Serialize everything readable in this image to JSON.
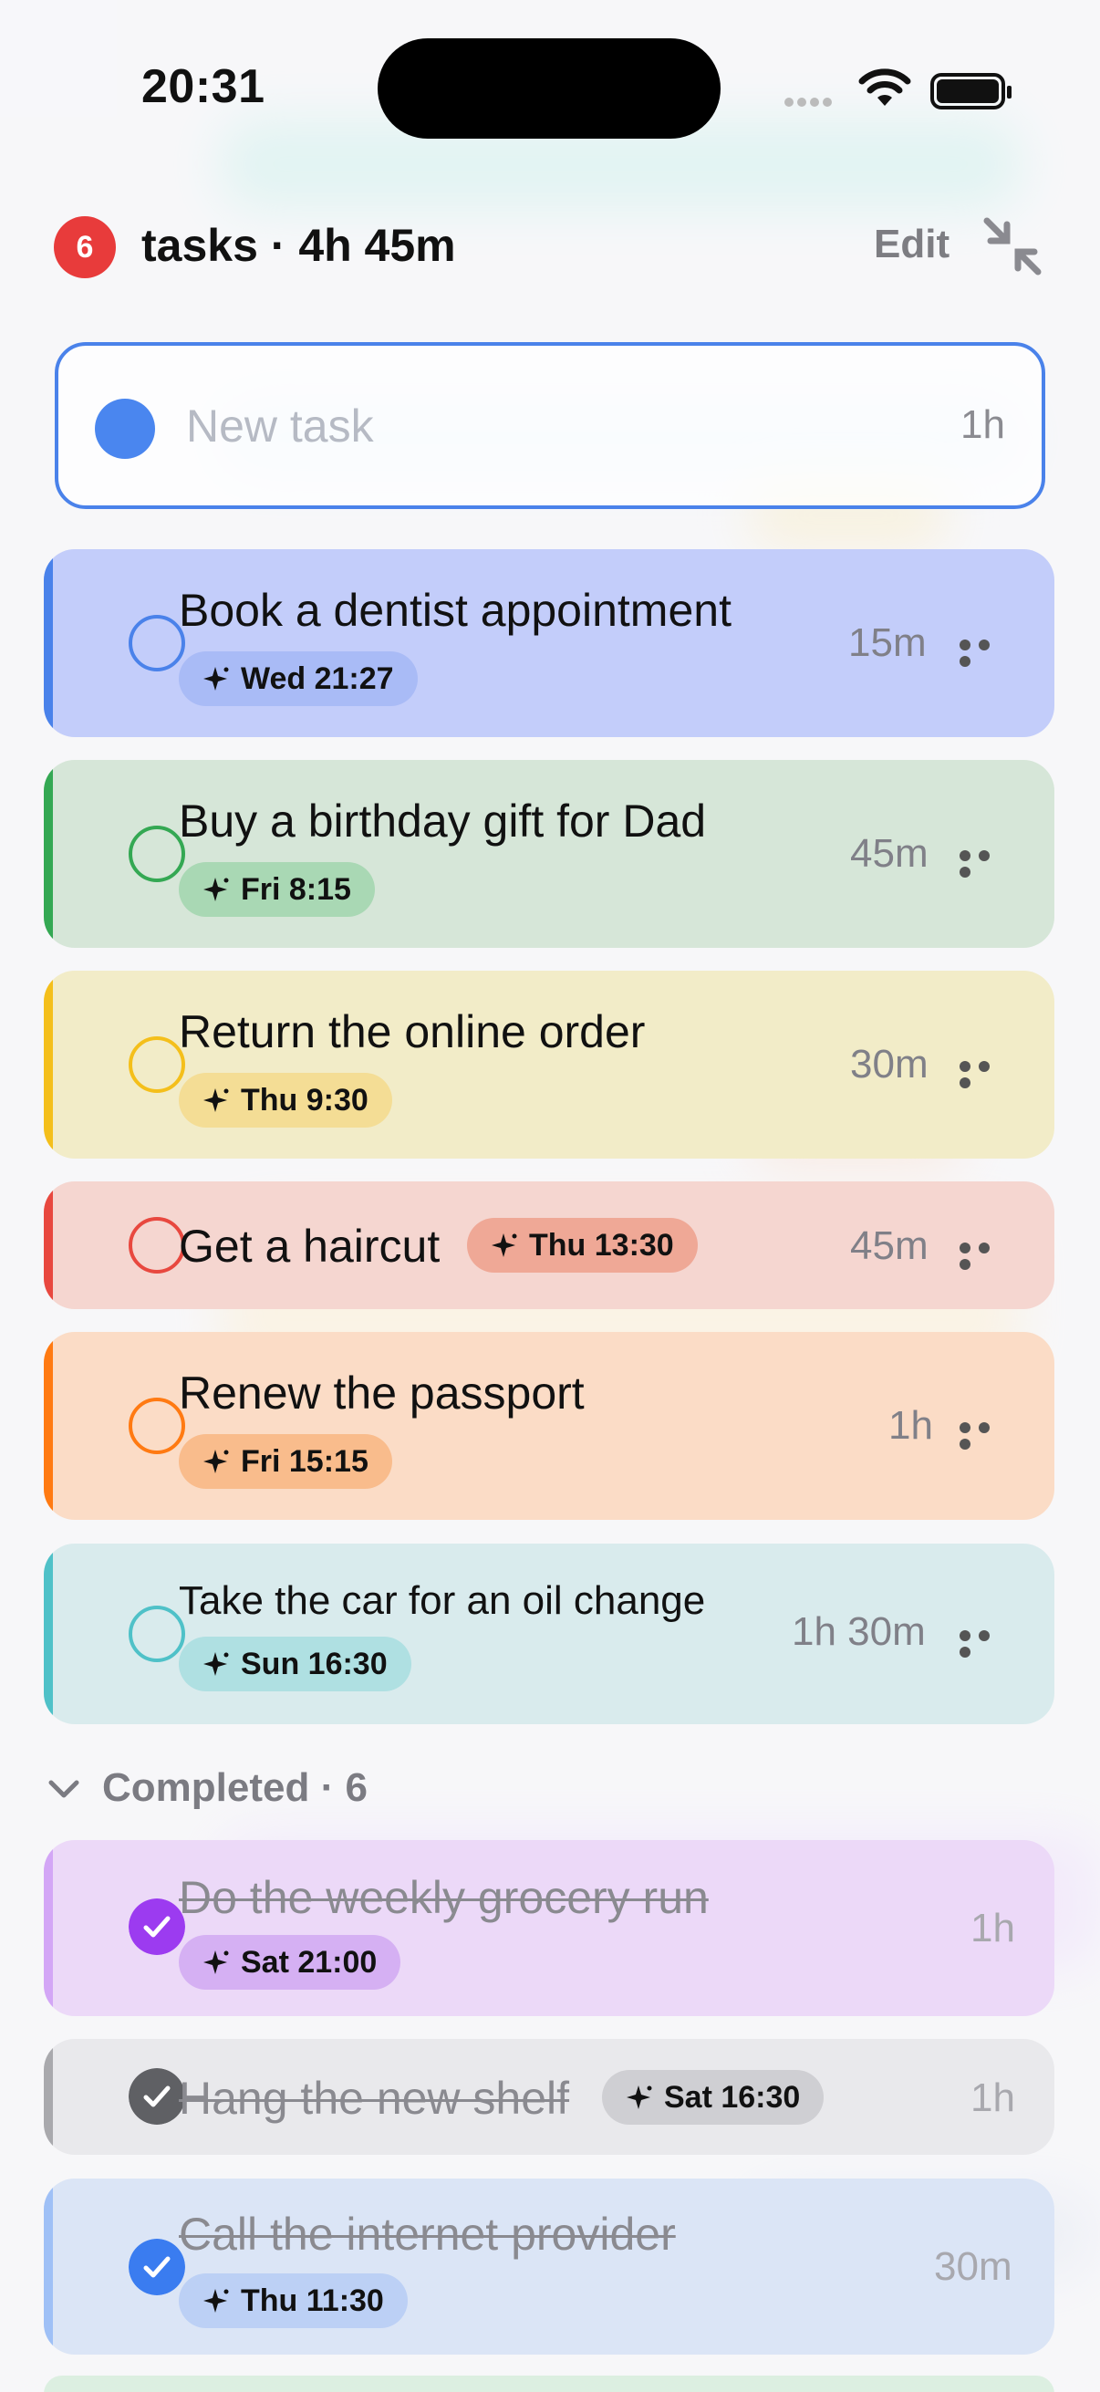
{
  "status_bar": {
    "time": "20:31"
  },
  "header": {
    "count": "6",
    "title": "tasks · 4h 45m",
    "edit_label": "Edit"
  },
  "new_task": {
    "placeholder": "New task",
    "duration": "1h",
    "color": "#4a86ef"
  },
  "tasks": [
    {
      "title": "Book a dentist appointment",
      "when": "Wed 21:27",
      "duration": "15m",
      "color": "#4a82ea",
      "bg": "#c3cdfa",
      "chip": "#a9bbf6"
    },
    {
      "title": "Buy a birthday gift for Dad",
      "when": "Fri 8:15",
      "duration": "45m",
      "color": "#34a853",
      "bg": "#d6e6d8",
      "chip": "#a9d8b4"
    },
    {
      "title": "Return the online order",
      "when": "Thu 9:30",
      "duration": "30m",
      "color": "#f4bf1b",
      "bg": "#f2ecc8",
      "chip": "#f4dd95"
    },
    {
      "title": "Get a haircut",
      "when": "Thu 13:30",
      "duration": "45m",
      "color": "#e8483f",
      "bg": "#f5d6d0",
      "chip": "#efa896"
    },
    {
      "title": "Renew the passport",
      "when": "Fri 15:15",
      "duration": "1h",
      "color": "#ff7a12",
      "bg": "#fbdcc6",
      "chip": "#f9bc8c"
    },
    {
      "title": "Take the car for an oil change",
      "when": "Sun 16:30",
      "duration": "1h 30m",
      "color": "#4fc1c8",
      "bg": "#d9ebed",
      "chip": "#afe0e2"
    }
  ],
  "completed": {
    "label": "Completed · 6",
    "items": [
      {
        "title": "Do the weekly grocery run",
        "when": "Sat 21:00",
        "duration": "1h",
        "color": "#9c3bf0",
        "bg": "#ecd9f8",
        "chip": "#d5b0f3"
      },
      {
        "title": "Hang the new shelf",
        "when": "Sat 16:30",
        "duration": "1h",
        "color": "#5f6064",
        "bg": "#e9e9ec",
        "chip": "#cfcfd3"
      },
      {
        "title": "Call the internet provider",
        "when": "Thu 11:30",
        "duration": "30m",
        "color": "#3a7cf0",
        "bg": "#dbe5f6",
        "chip": "#bcd0f5"
      }
    ]
  }
}
